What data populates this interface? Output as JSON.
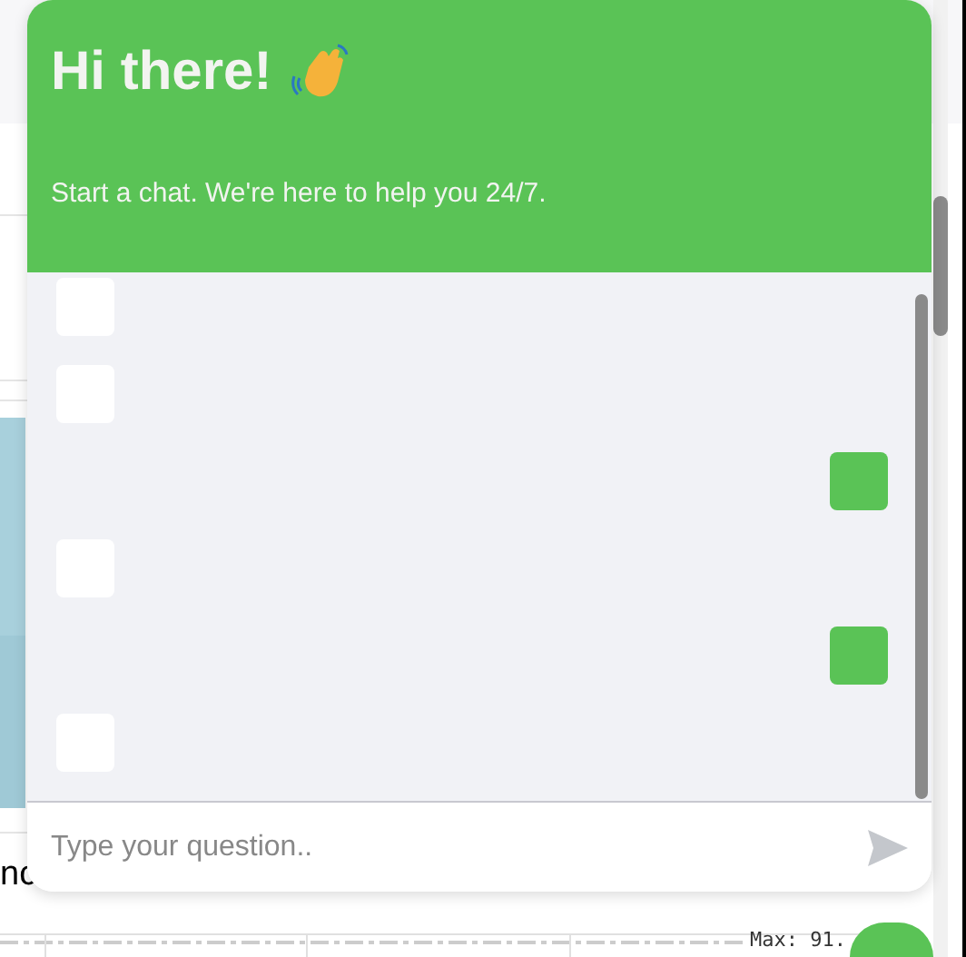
{
  "background": {
    "partial_word": "nc",
    "chart_label": "Max: 91."
  },
  "chat": {
    "title": "Hi there!",
    "subtitle": "Start a chat. We're here to help you 24/7.",
    "messages": [
      {
        "kind": "incoming"
      },
      {
        "kind": "incoming"
      },
      {
        "kind": "outgoing"
      },
      {
        "kind": "incoming"
      },
      {
        "kind": "outgoing"
      },
      {
        "kind": "incoming"
      }
    ],
    "input": {
      "placeholder": "Type your question.."
    }
  }
}
